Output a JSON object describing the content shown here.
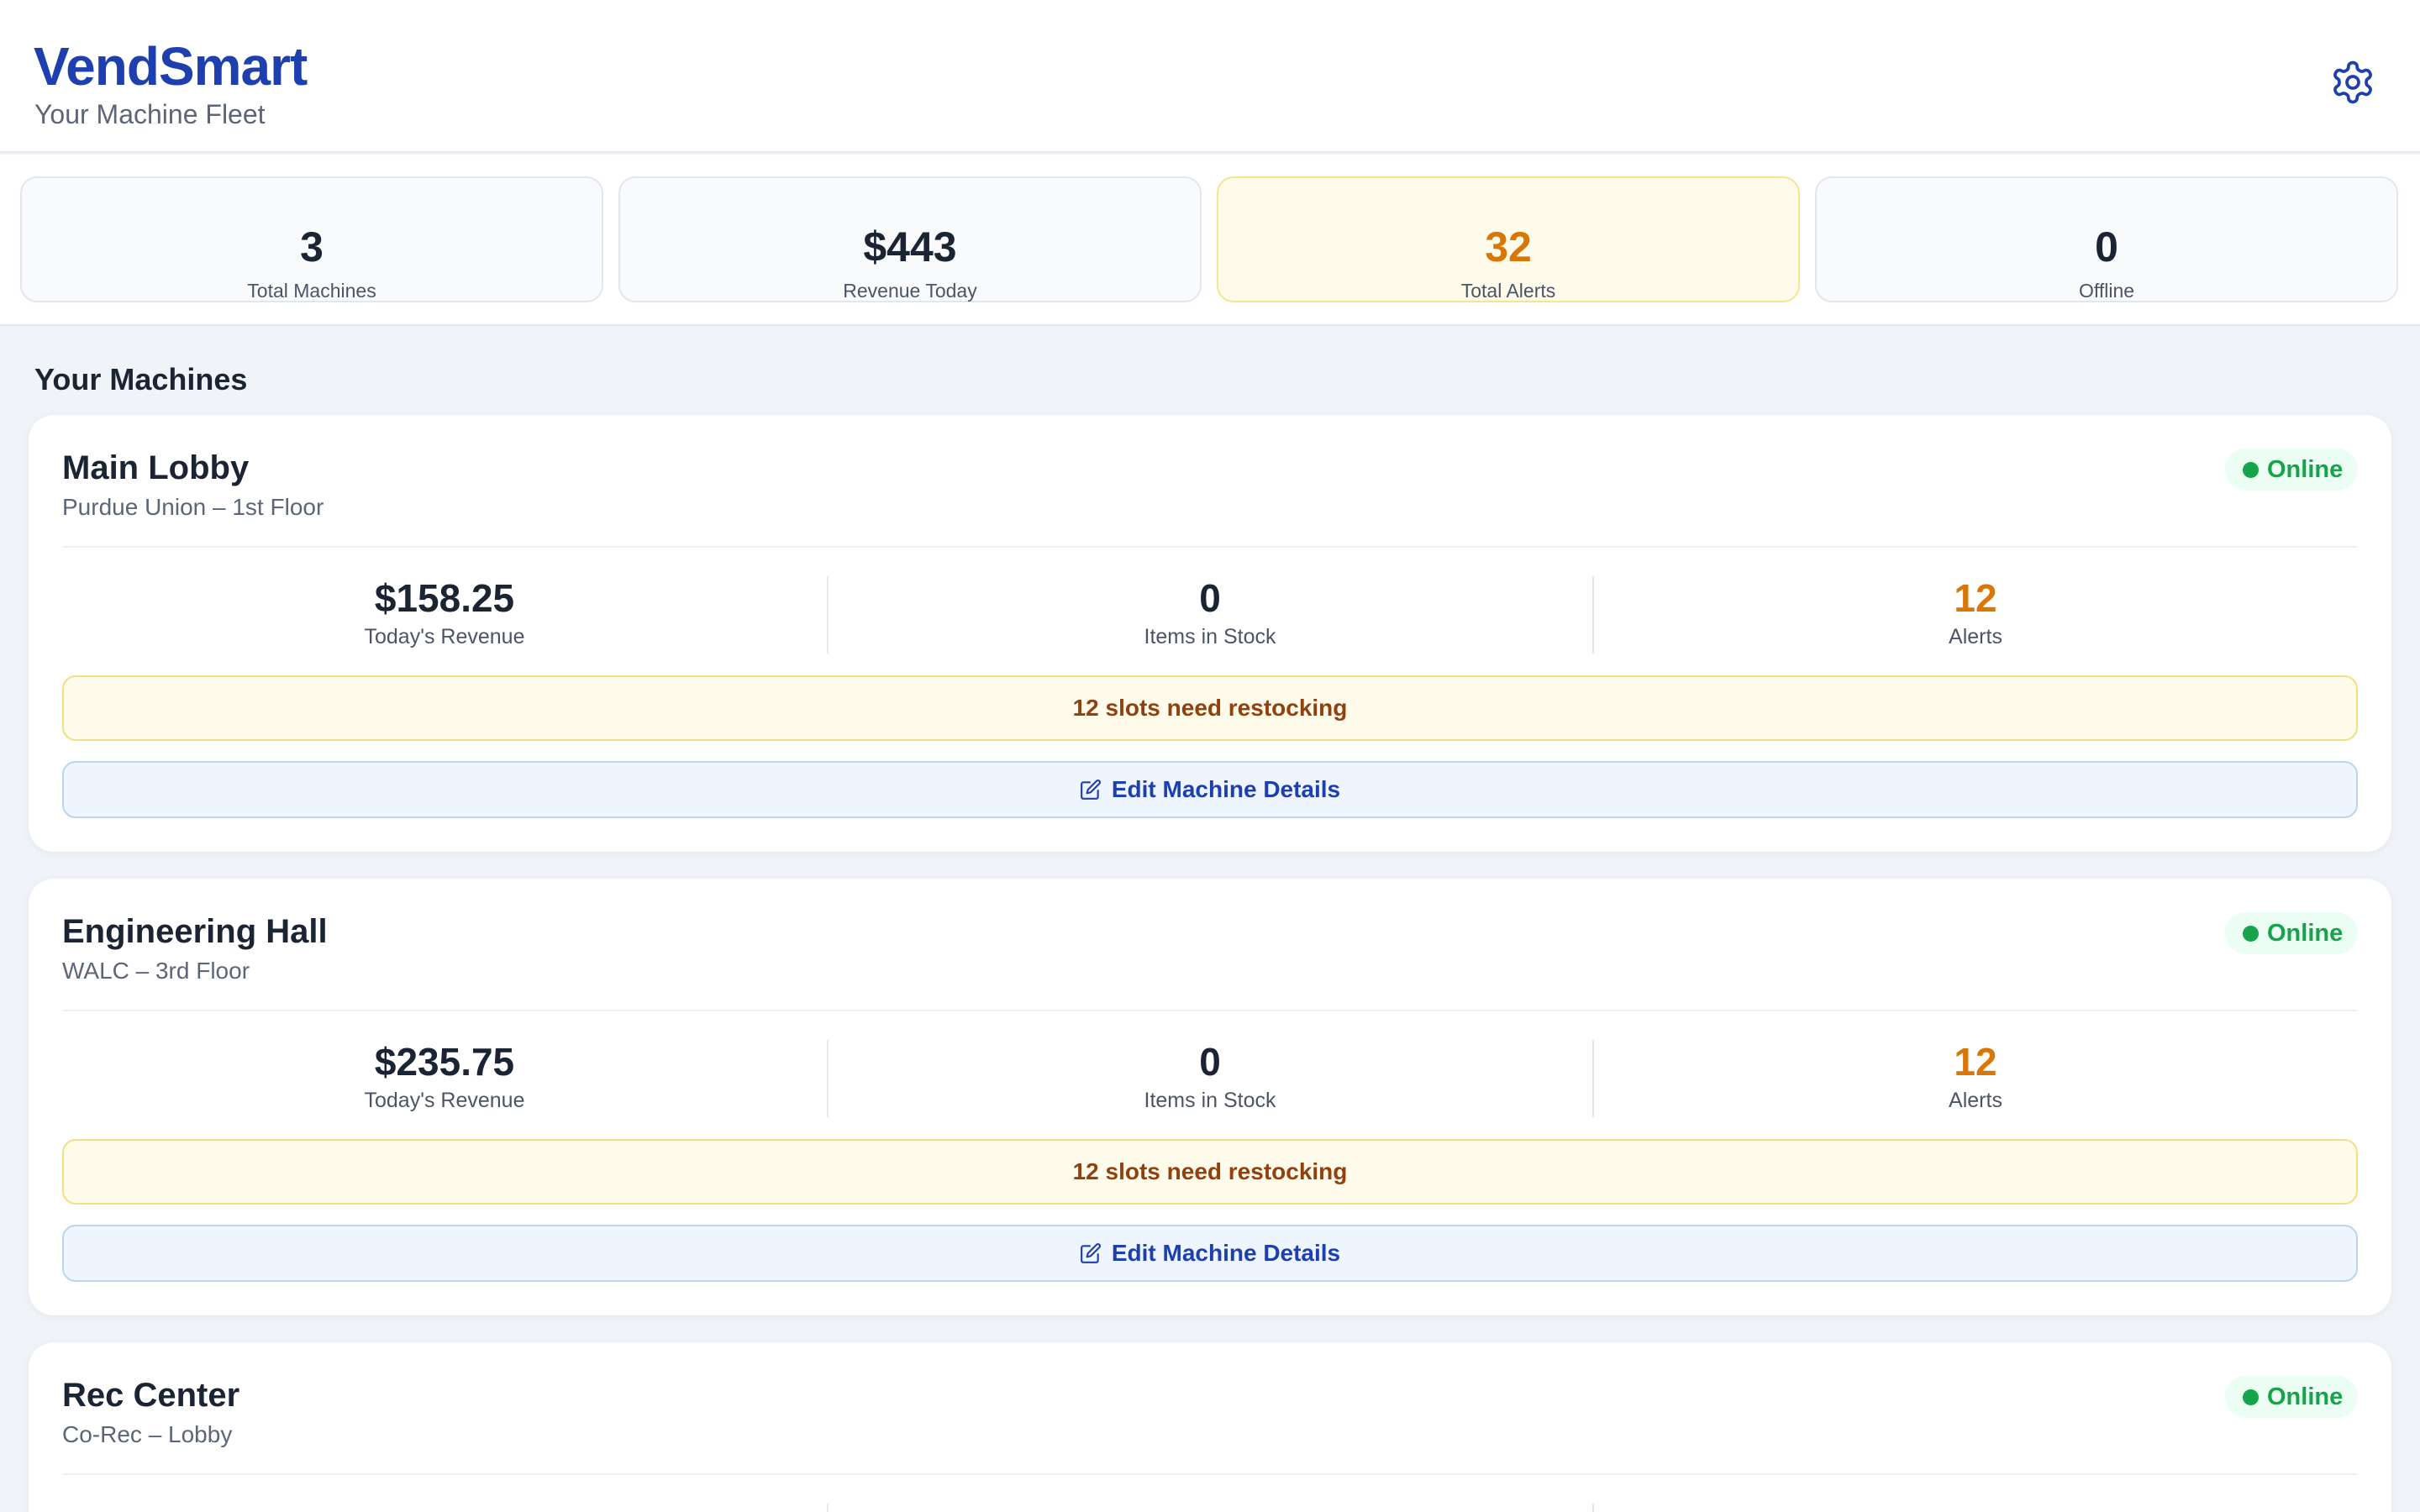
{
  "app": {
    "title": "VendSmart",
    "subtitle": "Your Machine Fleet",
    "settings_icon": "gear-icon"
  },
  "summary": [
    {
      "value": "3",
      "label": "Total Machines"
    },
    {
      "value": "$443",
      "label": "Revenue Today"
    },
    {
      "value": "32",
      "label": "Total Alerts",
      "highlight": "warning"
    },
    {
      "value": "0",
      "label": "Offline"
    }
  ],
  "section": {
    "title": "Your Machines"
  },
  "machines": [
    {
      "name": "Main Lobby",
      "location": "Purdue Union – 1st Floor",
      "status": "Online",
      "revenue": "$158.25",
      "revenue_label": "Today's Revenue",
      "stock": "0",
      "stock_label": "Items in Stock",
      "alerts": "12",
      "alerts_label": "Alerts",
      "notice": "12 slots need restocking",
      "action": "Edit Machine Details"
    },
    {
      "name": "Engineering Hall",
      "location": "WALC – 3rd Floor",
      "status": "Online",
      "revenue": "$235.75",
      "revenue_label": "Today's Revenue",
      "stock": "0",
      "stock_label": "Items in Stock",
      "alerts": "12",
      "alerts_label": "Alerts",
      "notice": "12 slots need restocking",
      "action": "Edit Machine Details"
    },
    {
      "name": "Rec Center",
      "location": "Co-Rec – Lobby",
      "status": "Online"
    }
  ],
  "colors": {
    "brand": "#1e40af",
    "online": "#16a34a",
    "alert": "#d97706",
    "notice_text": "#92400e"
  }
}
